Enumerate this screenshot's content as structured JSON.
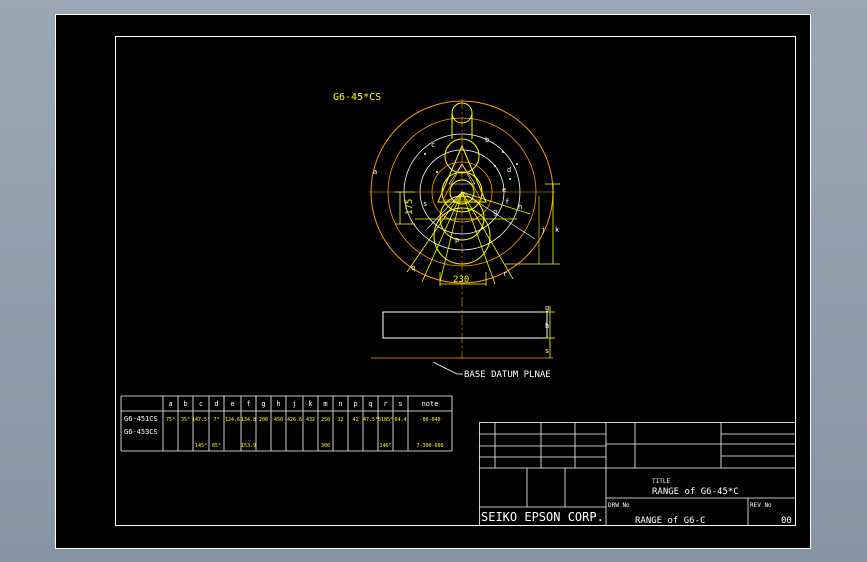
{
  "part_label": "G6-45*CS",
  "dimension_175": "175",
  "dimension_230": "230",
  "letters": {
    "a": "a",
    "b": "b",
    "c": "c",
    "d": "d",
    "e": "e",
    "f": "f",
    "g": "g",
    "h": "h",
    "j": "j",
    "k": "k",
    "p": "p",
    "q": "q",
    "r": "r",
    "s": "s"
  },
  "base_datum": "BASE DATUM PLNAE",
  "spec_table": {
    "headers": [
      "a",
      "b",
      "c",
      "d",
      "e",
      "f",
      "g",
      "h",
      "j",
      "k",
      "m",
      "n",
      "p",
      "q",
      "r",
      "s",
      "note"
    ],
    "rows": [
      {
        "name": "G6-451CS",
        "cells": [
          "75°",
          "35°",
          "147.5°",
          "7°",
          "124.6",
          "134.8",
          "200",
          "450",
          "426.6",
          "432",
          "250",
          "12",
          "42",
          "47.5°",
          "5185°",
          "64.4",
          "-80-040"
        ]
      },
      {
        "name": "G6-453CS",
        "cells": [
          "",
          "",
          "145°",
          "85°",
          "",
          "153.9",
          "",
          "",
          "",
          "",
          "300",
          "",
          "",
          "",
          "146°",
          "",
          "7-390-600"
        ]
      }
    ]
  },
  "title_block": {
    "title_label": "TITLE",
    "title_value": "RANGE of G6-45*C",
    "drw_label": "DRW No",
    "drw_value": "RANGE of G6-C",
    "rev_label": "REV No",
    "rev_value": "00",
    "company": "SEIKO EPSON CORP."
  },
  "colors": {
    "background": "#000000",
    "frame": "#ffffff",
    "part": "#ffff00",
    "arc": "#ff9900"
  }
}
